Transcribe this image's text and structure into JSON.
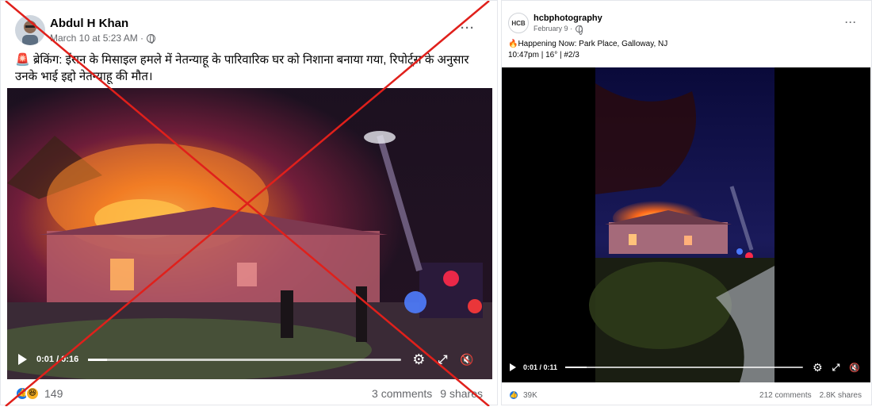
{
  "left_post": {
    "author": "Abdul H Khan",
    "timestamp": "March 10 at 5:23 AM ·",
    "more_label": "···",
    "caption_badge": "🚨",
    "caption": "ब्रेकिंग: ईरान के मिसाइल हमले में नेतन्याहू के पारिवारिक घर को निशाना बनाया गया, रिपोर्ट्स के अनुसार उनके भाई इद्दो नेतन्याहू की मौत।",
    "video": {
      "time": "0:01 / 0:16",
      "progress": 0.06
    },
    "reactions": {
      "count": "149",
      "icons": [
        "like-icon",
        "haha-icon"
      ]
    },
    "comments": "3 comments",
    "shares": "9 shares",
    "overlay": {
      "mark": "red-x-cross",
      "color": "#e0201b"
    }
  },
  "right_post": {
    "author": "hcbphotography",
    "avatar_text": "HCB",
    "timestamp": "February 9 ·",
    "more_label": "···",
    "caption_line1": "🔥Happening Now: Park Place, Galloway, NJ",
    "caption_line2": "10:47pm | 16° | #2/3",
    "video": {
      "time": "0:01 / 0:11",
      "progress": 0.09
    },
    "reactions": {
      "count": "39K",
      "icons": [
        "like-icon"
      ]
    },
    "comments": "212 comments",
    "shares": "2.8K shares"
  },
  "colors": {
    "facebook_blue": "#1b74e4",
    "secondary_text": "#65676b",
    "fire_orange": "#ff7a1a",
    "cross_red": "#e0201b"
  }
}
